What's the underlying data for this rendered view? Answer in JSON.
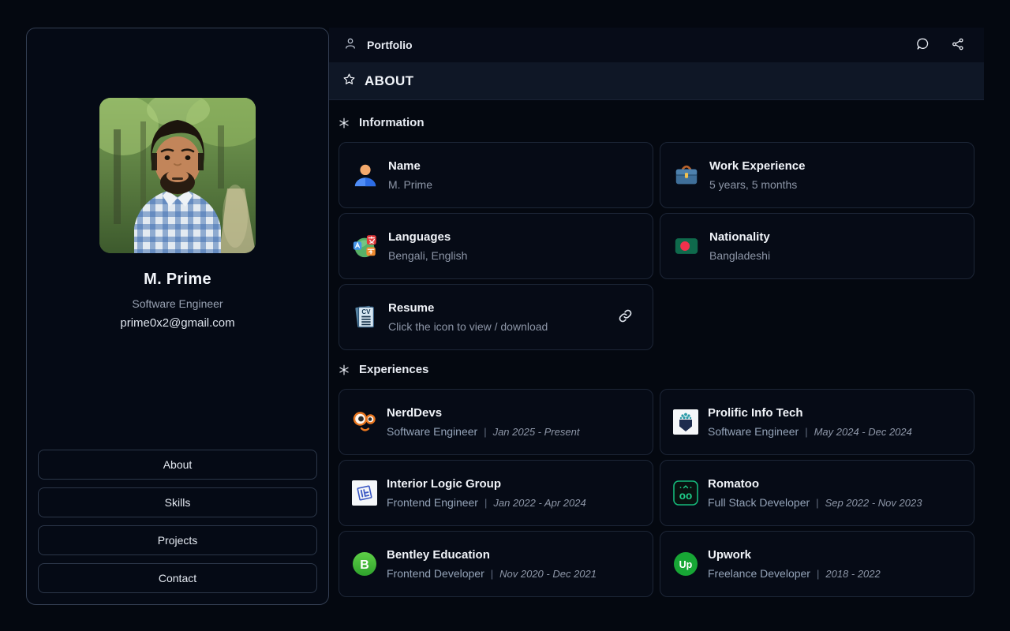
{
  "sidebar": {
    "name": "M. Prime",
    "title": "Software Engineer",
    "email": "prime0x2@gmail.com",
    "nav": [
      {
        "label": "About"
      },
      {
        "label": "Skills"
      },
      {
        "label": "Projects"
      },
      {
        "label": "Contact"
      }
    ]
  },
  "header": {
    "title": "Portfolio"
  },
  "about_bar": {
    "label": "ABOUT"
  },
  "info": {
    "heading": "Information",
    "cards": [
      {
        "icon": "person-emoji-icon",
        "title": "Name",
        "value": "M. Prime"
      },
      {
        "icon": "briefcase-emoji-icon",
        "title": "Work Experience",
        "value": "5 years, 5 months"
      },
      {
        "icon": "languages-globe-emoji-icon",
        "title": "Languages",
        "value": "Bengali, English"
      },
      {
        "icon": "bangladesh-flag-emoji-icon",
        "title": "Nationality",
        "value": "Bangladeshi"
      },
      {
        "icon": "cv-document-emoji-icon",
        "title": "Resume",
        "value": "Click the icon to view / download",
        "action_icon": "link-icon"
      }
    ]
  },
  "experiences": {
    "heading": "Experiences",
    "separator": "|",
    "items": [
      {
        "logo": "nerddevs-logo",
        "company": "NerdDevs",
        "role": "Software Engineer",
        "period": "Jan 2025 - Present"
      },
      {
        "logo": "prolific-info-tech-logo",
        "company": "Prolific Info Tech",
        "role": "Software Engineer",
        "period": "May 2024 - Dec 2024"
      },
      {
        "logo": "interior-logic-group-logo",
        "company": "Interior Logic Group",
        "role": "Frontend Engineer",
        "period": "Jan 2022 - Apr 2024"
      },
      {
        "logo": "romatoo-logo",
        "company": "Romatoo",
        "role": "Full Stack Developer",
        "period": "Sep 2022 - Nov 2023"
      },
      {
        "logo": "bentley-education-logo",
        "company": "Bentley Education",
        "role": "Frontend Developer",
        "period": "Nov 2020 - Dec 2021"
      },
      {
        "logo": "upwork-logo",
        "company": "Upwork",
        "role": "Freelance Developer",
        "period": "2018 - 2022"
      }
    ]
  },
  "icons": {
    "user-icon": "person outline glyph",
    "chat-icon": "speech-bubble outline glyph",
    "share-icon": "three connected nodes glyph",
    "star-icon": "star outline glyph",
    "asterisk-icon": "six-spoke asterisk glyph",
    "link-icon": "chain link glyph"
  },
  "colors": {
    "page_bg": "#040810",
    "panel_bg": "#060b16",
    "panel_border": "#1d2637",
    "about_bar_bg": "#0f1726",
    "text_primary": "#f1f4f9",
    "text_muted": "#8d96a7",
    "upwork_green": "#17a635",
    "bentley_green": "#3fbb3a",
    "romatoo_green": "#15b87a",
    "nerddevs_orange": "#e8761f"
  }
}
